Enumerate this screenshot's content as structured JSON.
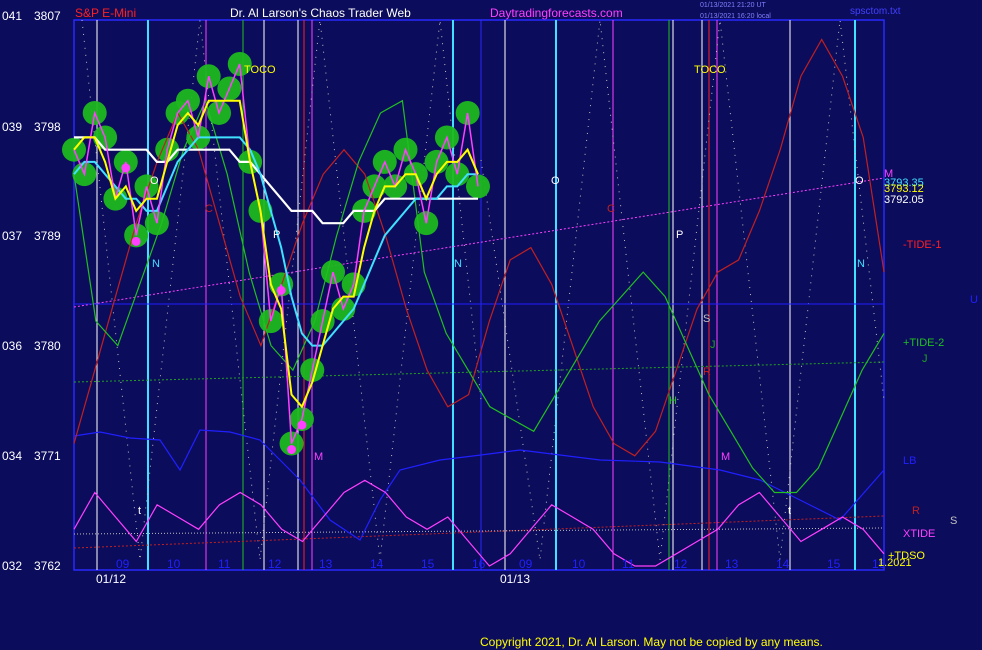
{
  "header": {
    "instrument": "S&P E-Mini",
    "title": "Dr. Al Larson's Chaos Trader Web",
    "site": "Daytradingforecasts.com",
    "timestamp_1": "01/13/2021 21:20 UT",
    "timestamp_2": "01/13/2021 16:20 local",
    "file": "spsctom.txt"
  },
  "footer": {
    "copyright": "Copyright 2021, Dr. Al Larson. May not be copied by any means."
  },
  "colors": {
    "background": "#0c0c5c",
    "axis": "#2828ff",
    "price_red": "#ff4040",
    "green_series": "#20c020",
    "white_series": "#ffffff",
    "yellow_series": "#ffff00",
    "cyan_series": "#40e0ff",
    "magenta_series": "#ff40ff",
    "dark_red": "#c02020",
    "blue_series": "#2020ff"
  },
  "chart_data": {
    "type": "line",
    "title": "S&P E-Mini",
    "ylim": [
      3762,
      3807
    ],
    "y_ticks": [
      {
        "code": "041",
        "price": "3807",
        "value": 3807
      },
      {
        "code": "039",
        "price": "3798",
        "value": 3798
      },
      {
        "code": "037",
        "price": "3789",
        "value": 3789
      },
      {
        "code": "036",
        "price": "3780",
        "value": 3780
      },
      {
        "code": "034",
        "price": "3771",
        "value": 3771
      },
      {
        "code": "032",
        "price": "3762",
        "value": 3762
      }
    ],
    "x_ticks": [
      "09",
      "10",
      "11",
      "12",
      "13",
      "14",
      "15",
      "16",
      "09",
      "10",
      "11",
      "12",
      "13",
      "14",
      "15",
      "16"
    ],
    "date_labels": [
      "01/12",
      "01/13"
    ],
    "right_labels": {
      "m": "M",
      "price_1": "3793.35",
      "price_2": "3793.12",
      "price_3": "3792.05",
      "tide_1": "-TIDE-1",
      "u": "U",
      "tide_2": "+TIDE-2",
      "j": "J",
      "lb": "LB",
      "r": "R",
      "s": "S",
      "xtide": "XTIDE",
      "tdso": "+TDSO",
      "year": "1.2021"
    },
    "annotations": [
      "TOCO",
      "TOCO",
      "O",
      "C",
      "P",
      "N",
      "M",
      "t",
      "O",
      "C",
      "P",
      "N",
      "S",
      "J",
      "R",
      "H",
      "M",
      "t",
      "O",
      "N"
    ],
    "series": [
      {
        "name": "S&P E-Mini",
        "color": "#ff40ff",
        "values": [
          3796,
          3794,
          3799,
          3797,
          3792,
          3795,
          3789,
          3793,
          3790,
          3796,
          3799,
          3800,
          3797,
          3802,
          3799,
          3801,
          3803,
          3795,
          3791,
          3782,
          3785,
          3772,
          3774,
          3778,
          3782,
          3786,
          3783,
          3785,
          3791,
          3793,
          3795,
          3793,
          3796,
          3794,
          3790,
          3795,
          3797,
          3794,
          3799,
          3793
        ]
      },
      {
        "name": "",
        "color": "#ffff00",
        "values": [
          3796,
          3797,
          3797,
          3795,
          3792,
          3793,
          3791,
          3792,
          3792,
          3795,
          3798,
          3799,
          3798,
          3800,
          3800,
          3800,
          3800,
          3795,
          3791,
          3785,
          3783,
          3776,
          3775,
          3777,
          3780,
          3783,
          3784,
          3784,
          3788,
          3791,
          3793,
          3793,
          3794,
          3794,
          3792,
          3794,
          3795,
          3795,
          3796,
          3794
        ]
      },
      {
        "name": "",
        "color": "#40e0ff",
        "values": [
          3794,
          3795,
          3795,
          3794,
          3793,
          3792,
          3792,
          3791,
          3791,
          3793,
          3795,
          3796,
          3797,
          3797,
          3797,
          3797,
          3797,
          3796,
          3794,
          3791,
          3788,
          3784,
          3781,
          3780,
          3780,
          3781,
          3782,
          3783,
          3785,
          3787,
          3789,
          3790,
          3791,
          3792,
          3792,
          3792,
          3793,
          3793,
          3794,
          3794
        ]
      },
      {
        "name": "",
        "color": "#ffffff",
        "values": [
          3797,
          3797,
          3797,
          3796,
          3796,
          3796,
          3796,
          3796,
          3795,
          3795,
          3796,
          3796,
          3796,
          3796,
          3796,
          3796,
          3795,
          3795,
          3794,
          3793,
          3792,
          3791,
          3791,
          3791,
          3790,
          3790,
          3790,
          3791,
          3791,
          3791,
          3792,
          3792,
          3792,
          3792,
          3792,
          3792,
          3792,
          3792,
          3792,
          3792
        ]
      },
      {
        "name": "-TIDE-1",
        "color": "#c02020",
        "values": [
          3772,
          3778,
          3784,
          3790,
          3795,
          3799,
          3796,
          3790,
          3784,
          3780,
          3785,
          3790,
          3794,
          3796,
          3794,
          3789,
          3783,
          3778,
          3775,
          3776,
          3782,
          3787,
          3788,
          3785,
          3780,
          3775,
          3772,
          3771,
          3773,
          3778,
          3783,
          3786,
          3787,
          3791,
          3796,
          3802,
          3805,
          3802,
          3797,
          3786
        ]
      },
      {
        "name": "+TIDE-2",
        "color": "#20c020",
        "values": [
          3794,
          3782,
          3780,
          3785,
          3790,
          3796,
          3800,
          3794,
          3786,
          3780,
          3778,
          3782,
          3789,
          3795,
          3799,
          3800,
          3786,
          3781,
          3778,
          3775,
          3774,
          3773,
          3776,
          3779,
          3782,
          3784,
          3786,
          3784,
          3780,
          3776,
          3773,
          3770,
          3768,
          3768,
          3770,
          3774,
          3778,
          3781
        ]
      },
      {
        "name": "XTIDE",
        "color": "#ff40ff",
        "values": [
          3765,
          3768,
          3766,
          3764,
          3767,
          3766,
          3765,
          3767,
          3768,
          3767,
          3765,
          3764,
          3766,
          3768,
          3769,
          3768,
          3766,
          3765,
          3766,
          3764,
          3762,
          3763,
          3765,
          3767,
          3766,
          3765,
          3763,
          3762,
          3762,
          3763,
          3764,
          3765,
          3767,
          3768,
          3766,
          3764,
          3765,
          3766,
          3765,
          3763
        ]
      }
    ]
  }
}
